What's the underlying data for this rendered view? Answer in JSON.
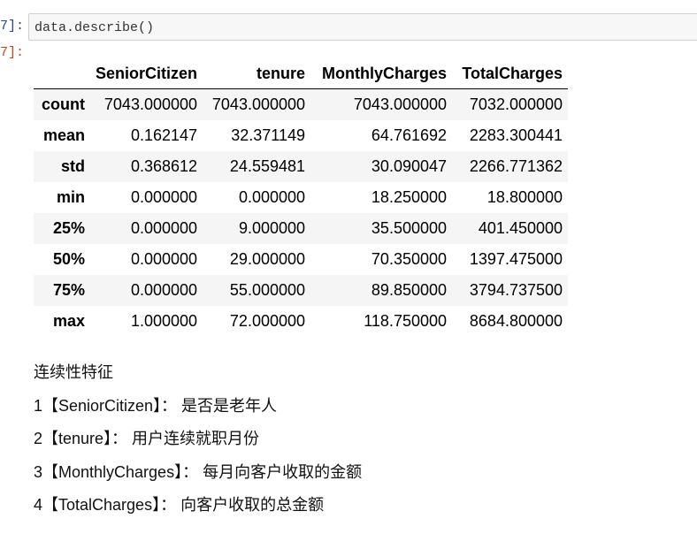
{
  "prompts": {
    "input": "7]:",
    "output": "7]:"
  },
  "code": "data.describe()",
  "table": {
    "columns": [
      "",
      "SeniorCitizen",
      "tenure",
      "MonthlyCharges",
      "TotalCharges"
    ],
    "rows": [
      {
        "label": "count",
        "values": [
          "7043.000000",
          "7043.000000",
          "7043.000000",
          "7032.000000"
        ]
      },
      {
        "label": "mean",
        "values": [
          "0.162147",
          "32.371149",
          "64.761692",
          "2283.300441"
        ]
      },
      {
        "label": "std",
        "values": [
          "0.368612",
          "24.559481",
          "30.090047",
          "2266.771362"
        ]
      },
      {
        "label": "min",
        "values": [
          "0.000000",
          "0.000000",
          "18.250000",
          "18.800000"
        ]
      },
      {
        "label": "25%",
        "values": [
          "0.000000",
          "9.000000",
          "35.500000",
          "401.450000"
        ]
      },
      {
        "label": "50%",
        "values": [
          "0.000000",
          "29.000000",
          "70.350000",
          "1397.475000"
        ]
      },
      {
        "label": "75%",
        "values": [
          "0.000000",
          "55.000000",
          "89.850000",
          "3794.737500"
        ]
      },
      {
        "label": "max",
        "values": [
          "1.000000",
          "72.000000",
          "118.750000",
          "8684.800000"
        ]
      }
    ]
  },
  "notes": [
    "连续性特征",
    "1【SeniorCitizen】： 是否是老年人",
    "2【tenure】： 用户连续就职月份",
    "3【MonthlyCharges】： 每月向客户收取的金额",
    "4【TotalCharges】： 向客户收取的总金额"
  ]
}
